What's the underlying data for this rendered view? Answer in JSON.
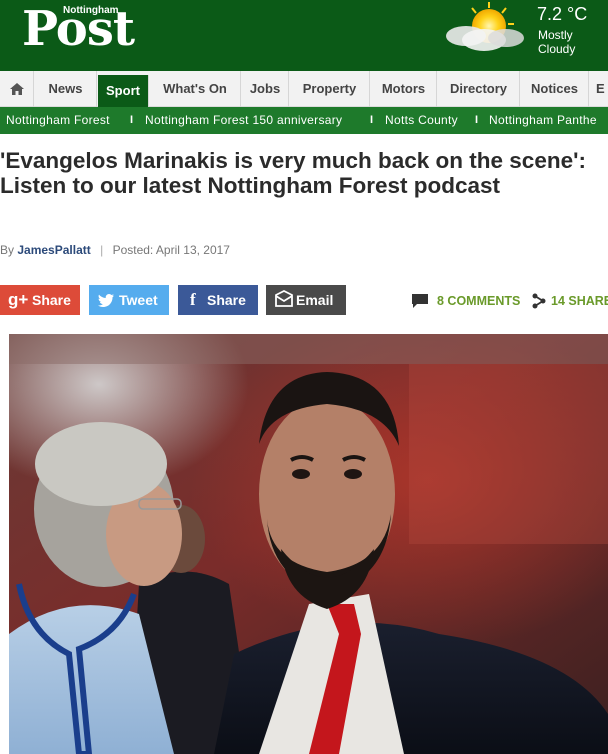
{
  "header": {
    "logo_small": "Nottingham",
    "logo_big": "Post",
    "weather": {
      "temperature": "7.2 °C",
      "condition": "Mostly Cloudy",
      "icon": "partly-cloudy-icon"
    }
  },
  "nav": {
    "home_icon": "home-icon",
    "items": [
      {
        "label": "News"
      },
      {
        "label": "Sport"
      },
      {
        "label": "What's On"
      },
      {
        "label": "Jobs"
      },
      {
        "label": "Property"
      },
      {
        "label": "Motors"
      },
      {
        "label": "Directory"
      },
      {
        "label": "Notices"
      },
      {
        "label": "E"
      }
    ],
    "active": "Sport"
  },
  "subnav": {
    "items": [
      {
        "label": "Nottingham Forest"
      },
      {
        "label": "Nottingham Forest 150 anniversary"
      },
      {
        "label": "Notts County"
      },
      {
        "label": "Nottingham Panthe"
      }
    ],
    "separator": "I"
  },
  "article": {
    "headline": "'Evangelos Marinakis is very much back on the scene': Listen to our latest Nottingham Forest podcast",
    "byline_prefix": "By",
    "author": "JamesPallatt",
    "separator": "|",
    "posted": "Posted: April 13, 2017"
  },
  "share": {
    "buttons": [
      {
        "label": "Share",
        "icon": "google-plus-icon",
        "glyph": "g+",
        "color": "#dd4b39"
      },
      {
        "label": "Tweet",
        "icon": "twitter-icon",
        "glyph": "",
        "color": "#55acee"
      },
      {
        "label": "Share",
        "icon": "facebook-icon",
        "glyph": "f",
        "color": "#3b5998"
      },
      {
        "label": "Email",
        "icon": "envelope-icon",
        "glyph": "",
        "color": "#4a4a4a"
      }
    ],
    "comments": "8 COMMENTS",
    "shares": "14 SHARE"
  },
  "colors": {
    "brand_green": "#0b5a17",
    "subnav_green": "#1e7a2b",
    "count_green": "#6a9a2a"
  }
}
